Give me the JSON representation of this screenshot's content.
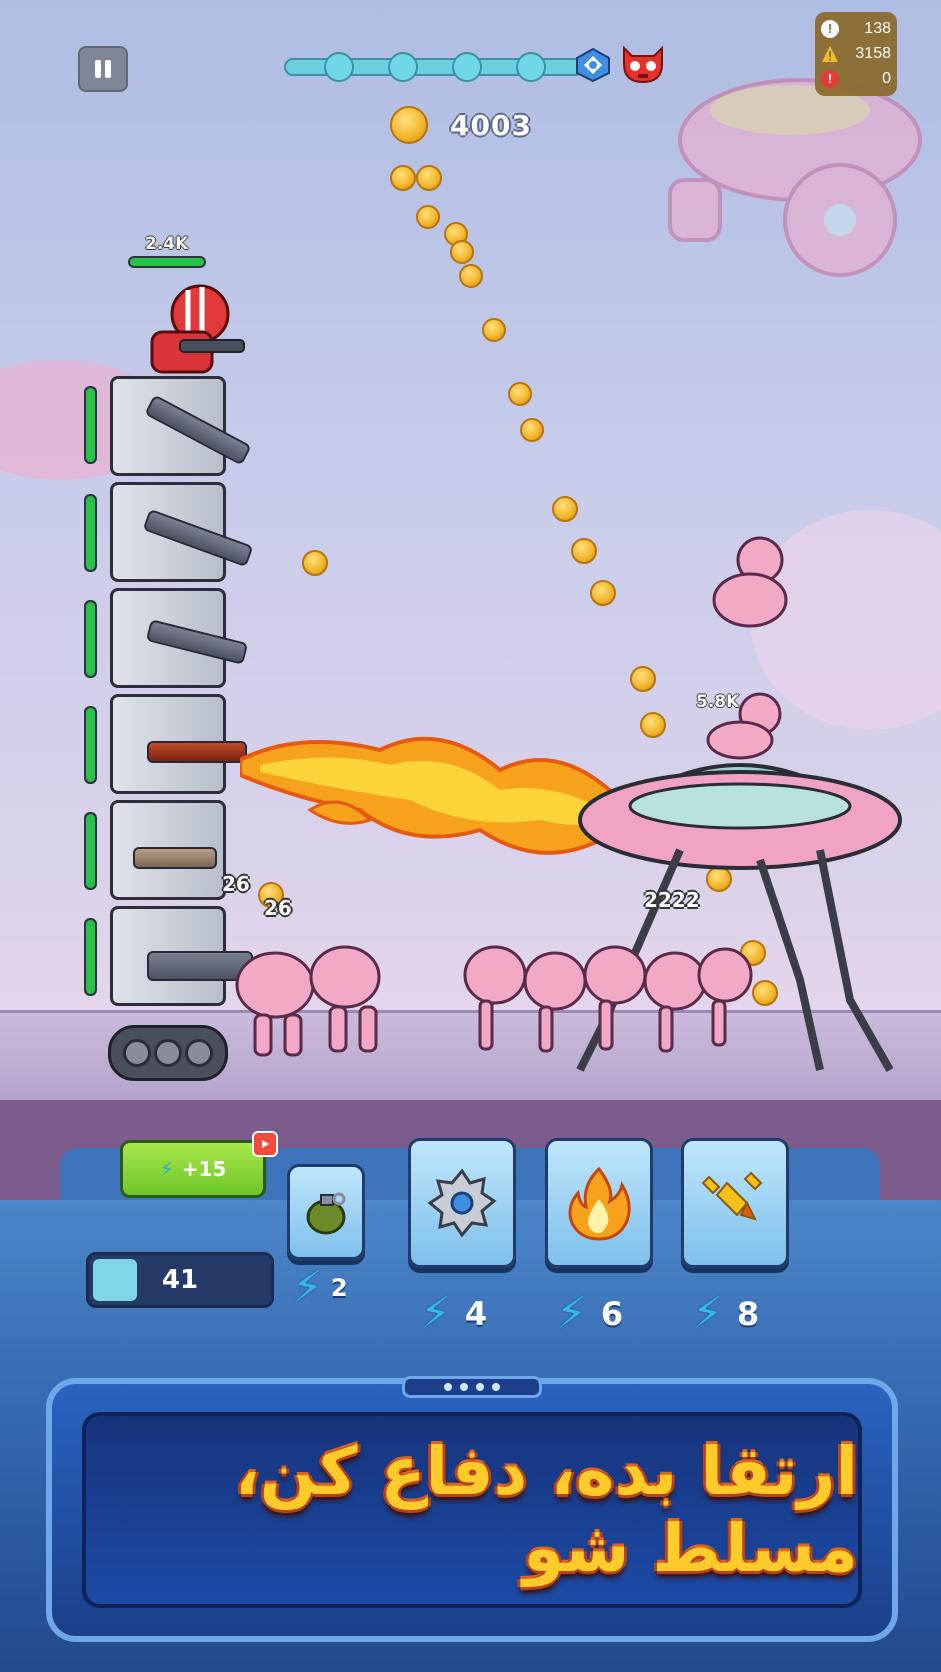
{
  "hud": {
    "coins": "4003",
    "stats": [
      {
        "icon": "exclamation-icon",
        "value": "138",
        "color": "#ffffff"
      },
      {
        "icon": "warning-icon",
        "value": "3158",
        "color": "#f5c01c"
      },
      {
        "icon": "alert-icon",
        "value": "0",
        "color": "#e5322b"
      }
    ]
  },
  "hero": {
    "hp_label": "2.4K"
  },
  "damage": {
    "a": "26",
    "b": "26",
    "c": "2222",
    "enemy_hp": "5.8K"
  },
  "controls": {
    "energy_bonus": "+15",
    "level_value": "41",
    "level_fill": 0.25,
    "grenade_cost": "2",
    "sawblade_cost": "4",
    "fire_cost": "6",
    "missile_cost": "8"
  },
  "banner": {
    "text": "ارتقا بده، دفاع کن، مسلط شو"
  },
  "colors": {
    "accent": "#ffcb2a",
    "energy": "#34b6e8",
    "health": "#27c24a"
  }
}
